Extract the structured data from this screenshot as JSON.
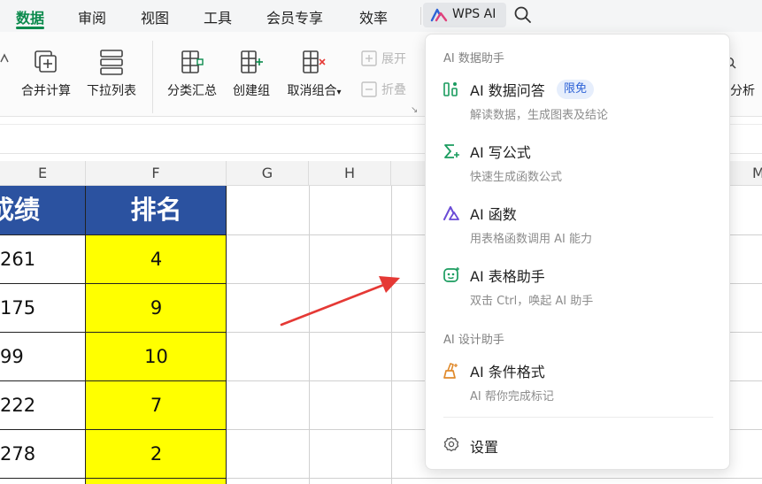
{
  "menu": {
    "tabs": [
      "数据",
      "审阅",
      "视图",
      "工具",
      "会员专享",
      "效率"
    ],
    "active_tab": "数据",
    "wps_ai_label": "WPS AI"
  },
  "ribbon": {
    "merge_calc": "合并计算",
    "dropdown_list": "下拉列表",
    "subtotal": "分类汇总",
    "create_group": "创建组",
    "ungroup": "取消组合",
    "expand": "展开",
    "collapse": "折叠",
    "right_cut": "分析"
  },
  "columns": [
    "E",
    "F",
    "G",
    "H",
    "M"
  ],
  "table": {
    "header_e": "成绩",
    "header_f": "排名",
    "rows": [
      {
        "score": "261",
        "rank": "4"
      },
      {
        "score": "175",
        "rank": "9"
      },
      {
        "score": "99",
        "rank": "10"
      },
      {
        "score": "222",
        "rank": "7"
      },
      {
        "score": "278",
        "rank": "2"
      }
    ]
  },
  "dropdown": {
    "group1": "AI 数据助手",
    "group2": "AI 设计助手",
    "items": [
      {
        "title": "AI 数据问答",
        "desc": "解读数据，生成图表及结论",
        "badge": "限免",
        "icon": "data-qa-icon"
      },
      {
        "title": "AI 写公式",
        "desc": "快速生成函数公式",
        "icon": "sigma-icon"
      },
      {
        "title": "AI 函数",
        "desc": "用表格函数调用 AI 能力",
        "icon": "ai-function-icon"
      },
      {
        "title": "AI 表格助手",
        "desc": "双击 Ctrl，唤起 AI 助手",
        "icon": "robot-icon"
      },
      {
        "title": "AI 条件格式",
        "desc": "AI 帮你完成标记",
        "icon": "brush-icon"
      }
    ],
    "settings": "设置"
  },
  "colors": {
    "accent_green": "#0b8a4c",
    "header_blue": "#2b52a0",
    "highlight_yellow": "#ffff00",
    "arrow_red": "#e53935"
  }
}
